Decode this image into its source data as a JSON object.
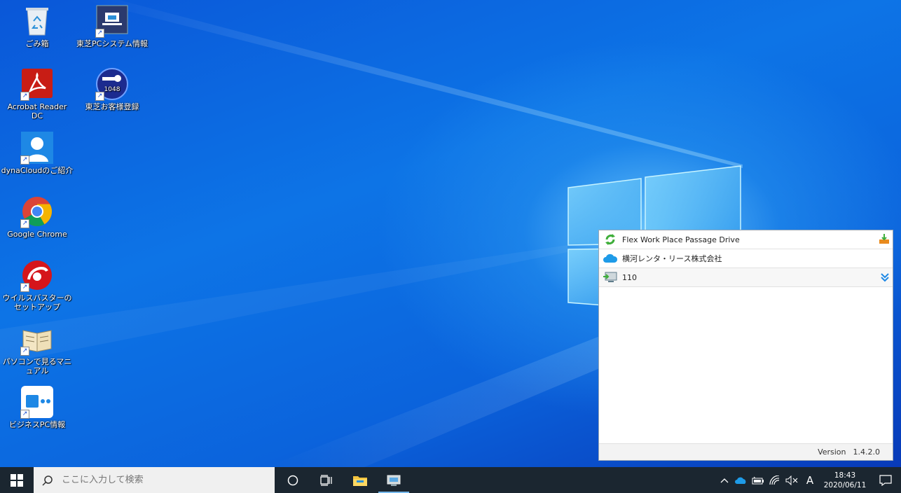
{
  "desktop_icons": [
    {
      "label": "ごみ箱",
      "icon": "recycle-bin-icon"
    },
    {
      "label": "東芝PCシステム情報",
      "icon": "system-info-icon"
    },
    {
      "label": "Acrobat Reader DC",
      "icon": "acrobat-icon"
    },
    {
      "label": "東芝お客様登録",
      "icon": "registration-key-icon"
    },
    {
      "label": "dynaCloudのご紹介",
      "icon": "dynacloud-user-icon"
    },
    {
      "label": "Google Chrome",
      "icon": "chrome-icon"
    },
    {
      "label": "ウイルスバスターのセットアップ",
      "icon": "virusbuster-icon"
    },
    {
      "label": "パソコンで見るマニュアル",
      "icon": "manual-book-icon"
    },
    {
      "label": "ビジネスPC情報",
      "icon": "business-pc-icon"
    }
  ],
  "panel": {
    "title": "Flex Work Place Passage Drive",
    "company": "横河レンタ・リース株式会社",
    "device": "110",
    "version_label": "Version",
    "version": "1.4.2.0"
  },
  "taskbar": {
    "search_placeholder": "ここに入力して検索",
    "ime_indicator": "A",
    "time": "18:43",
    "date": "2020/06/11"
  },
  "colors": {
    "taskbar_bg": "#1b2630",
    "desktop_accent": "#0d74e6",
    "active_indicator": "#76b9ed"
  }
}
